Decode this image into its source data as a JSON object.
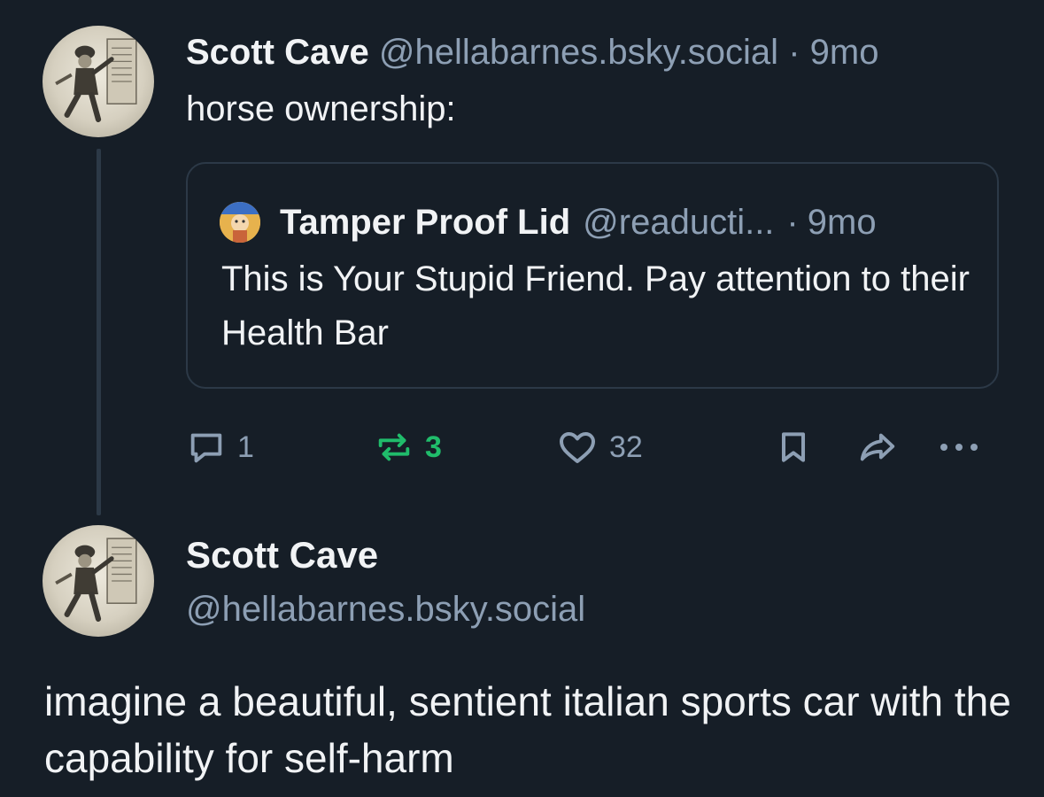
{
  "post1": {
    "author_name": "Scott Cave",
    "handle": "@hellabarnes.bsky.social",
    "separator": "·",
    "time": "9mo",
    "text": "horse ownership:",
    "avatar_icon": "vintage-illustration-avatar"
  },
  "quote": {
    "author_name": "Tamper Proof Lid",
    "handle": "@readucti...",
    "separator": "·",
    "time": "9mo",
    "text": "This is Your Stupid Friend. Pay attention to their Health Bar",
    "avatar_icon": "cartoon-avatar"
  },
  "actions": {
    "reply_count": "1",
    "repost_count": "3",
    "like_count": "32",
    "icons": [
      "reply-icon",
      "repost-icon",
      "like-icon",
      "bookmark-icon",
      "share-icon",
      "more-icon"
    ]
  },
  "post2": {
    "author_name": "Scott Cave",
    "handle": "@hellabarnes.bsky.social",
    "text": "imagine a beautiful, sentient italian sports car with the capability for self-harm",
    "avatar_icon": "vintage-illustration-avatar"
  },
  "colors": {
    "background": "#161e27",
    "text": "#f1f3f5",
    "muted": "#8d9fb4",
    "repost_active": "#20bc6b",
    "border": "#2c3947"
  }
}
